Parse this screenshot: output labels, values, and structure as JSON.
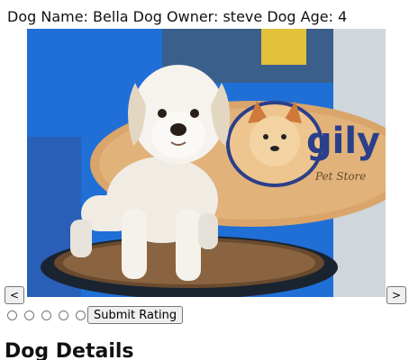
{
  "dog_info": {
    "name_label": "Dog Name:",
    "name": "Bella",
    "owner_label": "Dog Owner:",
    "owner": "steve",
    "age_label": "Dog Age:",
    "age": "4"
  },
  "carousel": {
    "prev_label": "<",
    "next_label": ">"
  },
  "rating": {
    "options": [
      "1",
      "2",
      "3",
      "4",
      "5"
    ],
    "submit_label": "Submit Rating"
  },
  "section_title": "Dog Details",
  "photo_sign_text": "gily",
  "photo_sign_subtext": "Pet Store"
}
